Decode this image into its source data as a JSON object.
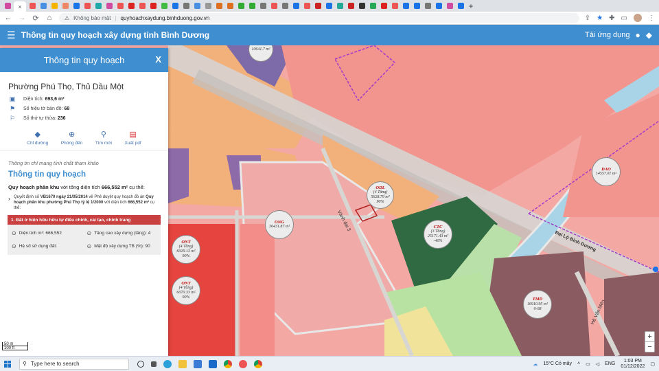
{
  "browser": {
    "tab_colors": [
      "#d14ba0",
      "#e55",
      "#4a90e2",
      "#f5b400",
      "#e86",
      "#1a73e8",
      "#e55",
      "#2aa",
      "#d14ba0",
      "#e55",
      "#d22",
      "#e55",
      "#d22",
      "#4b4",
      "#1a73e8",
      "#777",
      "#4a90e2",
      "#999",
      "#e07020",
      "#e07020",
      "#3a3",
      "#3a3",
      "#777",
      "#e55",
      "#777",
      "#1a73e8",
      "#e55",
      "#c22",
      "#1a73e8",
      "#2a9",
      "#c22",
      "#333",
      "#2a5",
      "#d22",
      "#e55",
      "#1a73e8",
      "#1a73e8",
      "#777",
      "#1a73e8",
      "#d14ba0",
      "#1a73e8"
    ],
    "active_tab_close": "×",
    "new_tab": "+",
    "security_text": "Không bảo mật",
    "url": "quyhoachxaydung.binhduong.gov.vn"
  },
  "app": {
    "title": "Thông tin quy hoạch xây dựng tỉnh Bình Dương",
    "download_label": "Tải ứng dụng",
    "colors": {
      "header": "#3e8ed0"
    }
  },
  "panel": {
    "title": "Thông tin quy hoạch",
    "close": "X",
    "location": "Phường Phú Thọ, Thủ Dầu Một",
    "area_label": "Diện tích: ",
    "area_value": "693,6 m²",
    "map_sheet_label": "Số hiệu tờ bản đồ: ",
    "map_sheet_value": "68",
    "parcel_label": "Số thứ tự thửa: ",
    "parcel_value": "236",
    "actions": [
      {
        "icon": "directions-icon",
        "label": "Chỉ đường"
      },
      {
        "icon": "zoom-in-icon",
        "label": "Phóng đến"
      },
      {
        "icon": "search-icon",
        "label": "Tìm mới"
      },
      {
        "icon": "pdf-icon",
        "label": "Xuất pdf"
      }
    ],
    "disclaimer": "Thông tin chỉ mang tính chất tham khảo",
    "section_title": "Thông tin quy hoạch",
    "qh_label": "Quy hoạch phân khu",
    "qh_text": " với tổng diện tích ",
    "qh_area": "666,552 m²",
    "qh_tail": " cụ thể:",
    "decision_prefix": "Quyết định số ",
    "decision_no": "VB1670 ngày 21/05/2014",
    "decision_mid": " về Phê duyệt quy hoạch đồ án ",
    "decision_name": "Quy hoạch phân khu phường Phú Thọ tỷ lệ 1/2000",
    "decision_area_text": " với diện tích ",
    "decision_area": "666,552 m²",
    "decision_tail": " cụ thể:",
    "zone_title": "1. Đất ở hiện hữu hữu tự điều chỉnh, cải tạo, chỉnh trang",
    "zone_area": "Diện tích m²: 666,552",
    "zone_floors": "Tầng cao xây dựng (tầng): 4",
    "zone_usage": "Hệ số sử dụng đất:",
    "zone_density": "Mật độ xây dựng TB (%): 90"
  },
  "map": {
    "badges": [
      {
        "code": "",
        "l1": "10641.7 m²",
        "l2": "",
        "l3": ""
      },
      {
        "code": "ODL",
        "l1": "(4 Tầng)",
        "l2": "5628.79 m²",
        "l3": "90%"
      },
      {
        "code": "CTC",
        "l1": "(3 Tầng)",
        "l2": "25171.43 m²",
        "l3": "-40%"
      },
      {
        "code": "DAO",
        "l1": "14557.01 m²",
        "l2": "",
        "l3": ""
      },
      {
        "code": "ONG",
        "l1": "30431.87 m²",
        "l2": "",
        "l3": ""
      },
      {
        "code": "ONT",
        "l1": "(4 Tầng)",
        "l2": "6029.13 m²",
        "l3": "90%"
      },
      {
        "code": "ONT",
        "l1": "(4 Tầng)",
        "l2": "6070.33 m²",
        "l3": "90%"
      },
      {
        "code": "TMD",
        "l1": "16910.95 m²",
        "l2": "0-08",
        "l3": ""
      }
    ],
    "roads": [
      "Đại Lộ Bình Dương",
      "Vành đai 3",
      "Hồ Văn Mên"
    ],
    "scale_top": "50 m",
    "scale_bottom": "100 ft",
    "zoom_in": "+",
    "zoom_out": "−"
  },
  "taskbar": {
    "search_placeholder": "Type here to search",
    "weather": "15°C  Có mây",
    "lang": "ENG",
    "time": "1:03 PM",
    "date": "01/12/2022"
  }
}
